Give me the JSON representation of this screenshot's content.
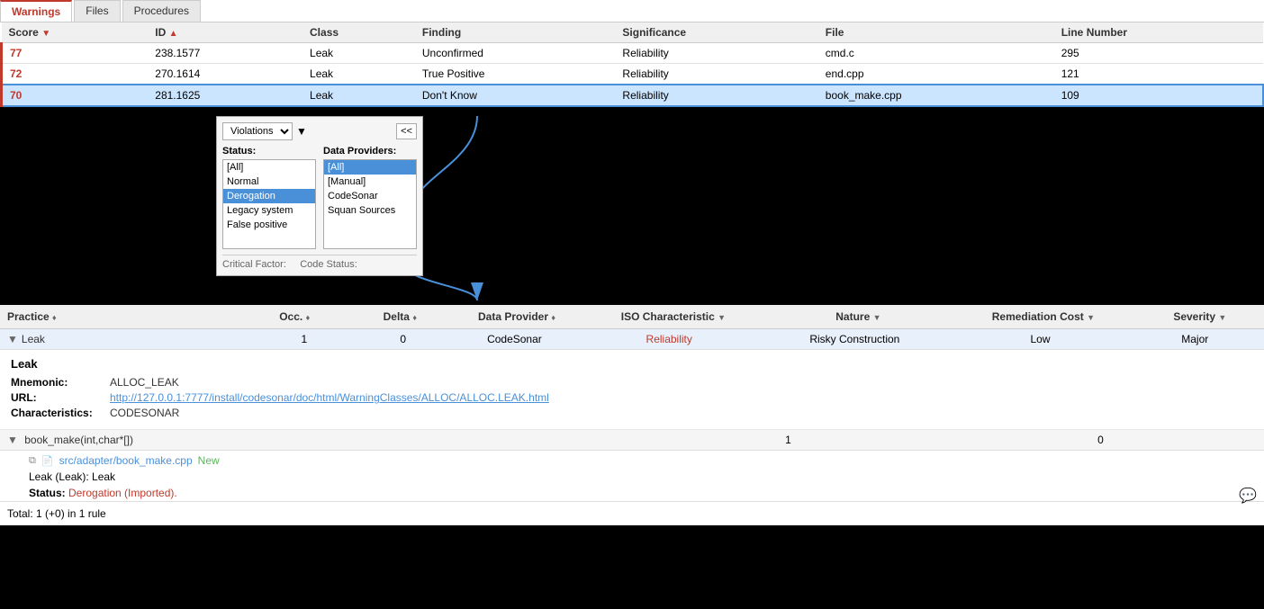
{
  "tabs": [
    {
      "id": "warnings",
      "label": "Warnings",
      "active": true
    },
    {
      "id": "files",
      "label": "Files",
      "active": false
    },
    {
      "id": "procedures",
      "label": "Procedures",
      "active": false
    }
  ],
  "table": {
    "columns": [
      {
        "label": "Score",
        "sort": "desc",
        "id": "score"
      },
      {
        "label": "ID",
        "sort": "asc",
        "id": "id"
      },
      {
        "label": "Class",
        "id": "class"
      },
      {
        "label": "Finding",
        "id": "finding"
      },
      {
        "label": "Significance",
        "id": "significance"
      },
      {
        "label": "File",
        "id": "file"
      },
      {
        "label": "Line Number",
        "id": "line_number"
      }
    ],
    "rows": [
      {
        "score": "77",
        "id": "238.1577",
        "class": "Leak",
        "finding": "Unconfirmed",
        "significance": "Reliability",
        "file": "cmd.c",
        "line_number": "295",
        "selected": false
      },
      {
        "score": "72",
        "id": "270.1614",
        "class": "Leak",
        "finding": "True Positive",
        "significance": "Reliability",
        "file": "end.cpp",
        "line_number": "121",
        "selected": false
      },
      {
        "score": "70",
        "id": "281.1625",
        "class": "Leak",
        "finding": "Don't Know",
        "significance": "Reliability",
        "file": "book_make.cpp",
        "line_number": "109",
        "selected": true
      }
    ]
  },
  "popup": {
    "title": "Violations",
    "collapse_btn": "<<",
    "status_label": "Status:",
    "data_providers_label": "Data Providers:",
    "status_items": [
      {
        "label": "[All]",
        "selected": false
      },
      {
        "label": "Normal",
        "selected": false
      },
      {
        "label": "Derogation",
        "selected": true
      },
      {
        "label": "Legacy system",
        "selected": false
      },
      {
        "label": "False positive",
        "selected": false
      }
    ],
    "data_provider_items": [
      {
        "label": "[All]",
        "selected": true
      },
      {
        "label": "[Manual]",
        "selected": false
      },
      {
        "label": "CodeSonar",
        "selected": false
      },
      {
        "label": "Squan Sources",
        "selected": false
      }
    ],
    "footer_label1": "Critical Factor:",
    "footer_label2": "Code Status:"
  },
  "bottom": {
    "columns": [
      {
        "label": "Practice",
        "sort": "asc"
      },
      {
        "label": "Occ.",
        "sort": "asc"
      },
      {
        "label": "Delta",
        "sort": "asc"
      },
      {
        "label": "Data Provider",
        "sort": "asc"
      },
      {
        "label": "ISO Characteristic",
        "sort": "desc"
      },
      {
        "label": "Nature",
        "sort": "desc"
      },
      {
        "label": "Remediation Cost",
        "sort": "desc"
      },
      {
        "label": "Severity",
        "sort": "desc"
      }
    ],
    "leak_row": {
      "name": "Leak",
      "occ": "1",
      "delta": "0",
      "provider": "CodeSonar",
      "iso": "Reliability",
      "nature": "Risky Construction",
      "remediation": "Low",
      "severity": "Major"
    },
    "detail": {
      "title": "Leak",
      "mnemonic_label": "Mnemonic:",
      "mnemonic_value": "ALLOC_LEAK",
      "url_label": "URL:",
      "url_value": "http://127.0.0.1:7777/install/codesonar/doc/html/WarningClasses/ALLOC/ALLOC.LEAK.html",
      "chars_label": "Characteristics:",
      "chars_value": "CODESONAR"
    },
    "subrow": {
      "func": "book_make(int,char*[])",
      "occ": "1",
      "delta": "0"
    },
    "file": {
      "path": "src/adapter/book_make.cpp",
      "badge": "New"
    },
    "warning": {
      "text": "Leak (Leak): Leak"
    },
    "status": {
      "label": "Status:",
      "value": "Derogation (Imported)."
    },
    "total": "Total: 1 (+0) in 1 rule"
  }
}
